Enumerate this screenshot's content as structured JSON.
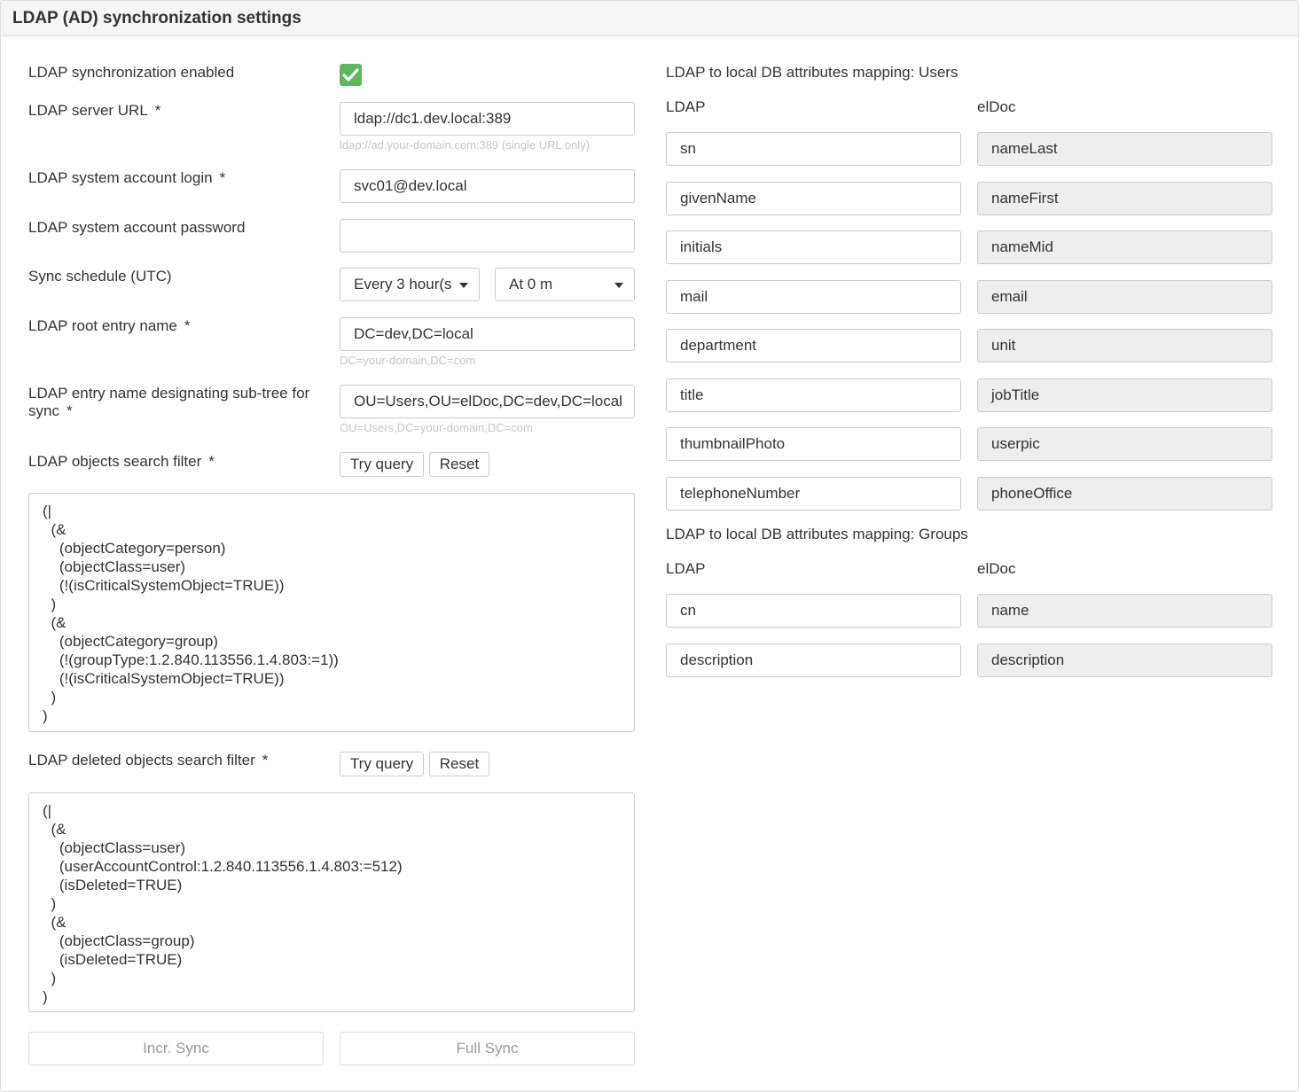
{
  "header": {
    "title": "LDAP (AD) synchronization settings"
  },
  "form": {
    "sync_enabled": {
      "label": "LDAP synchronization enabled",
      "checked": true
    },
    "server_url": {
      "label": "LDAP server URL",
      "required": "*",
      "value": "ldap://dc1.dev.local:389",
      "help": "ldap://ad.your-domain.com:389 (single URL only)"
    },
    "account_login": {
      "label": "LDAP system account login",
      "required": "*",
      "value": "svc01@dev.local"
    },
    "account_password": {
      "label": "LDAP system account password",
      "value": ""
    },
    "schedule": {
      "label": "Sync schedule (UTC)",
      "interval": "Every 3 hour(s",
      "minute": "At 0 m"
    },
    "root_entry": {
      "label": "LDAP root entry name",
      "required": "*",
      "value": "DC=dev,DC=local",
      "help": "DC=your-domain,DC=com"
    },
    "subtree": {
      "label_line1": "LDAP entry name designating sub-tree for",
      "label_line2": "sync",
      "required": "*",
      "value": "OU=Users,OU=elDoc,DC=dev,DC=local",
      "help": "OU=Users,DC=your-domain,DC=com"
    },
    "search_filter": {
      "label": "LDAP objects search filter",
      "required": "*",
      "try_label": "Try query",
      "reset_label": "Reset",
      "value": "(|\n  (&\n    (objectCategory=person)\n    (objectClass=user)\n    (!(isCriticalSystemObject=TRUE))\n  )\n  (&\n    (objectCategory=group)\n    (!(groupType:1.2.840.113556.1.4.803:=1))\n    (!(isCriticalSystemObject=TRUE))\n  )\n)"
    },
    "deleted_filter": {
      "label": "LDAP deleted objects search filter",
      "required": "*",
      "try_label": "Try query",
      "reset_label": "Reset",
      "value": "(|\n  (&\n    (objectClass=user)\n    (userAccountControl:1.2.840.113556.1.4.803:=512)\n    (isDeleted=TRUE)\n  )\n  (&\n    (objectClass=group)\n    (isDeleted=TRUE)\n  )\n)"
    },
    "incr_sync_label": "Incr. Sync",
    "full_sync_label": "Full Sync"
  },
  "users_mapping": {
    "title": "LDAP to local DB attributes mapping: Users",
    "col_ldap": "LDAP",
    "col_local": "elDoc",
    "rows": [
      {
        "ldap": "sn",
        "local": "nameLast"
      },
      {
        "ldap": "givenName",
        "local": "nameFirst"
      },
      {
        "ldap": "initials",
        "local": "nameMid"
      },
      {
        "ldap": "mail",
        "local": "email"
      },
      {
        "ldap": "department",
        "local": "unit"
      },
      {
        "ldap": "title",
        "local": "jobTitle"
      },
      {
        "ldap": "thumbnailPhoto",
        "local": "userpic"
      },
      {
        "ldap": "telephoneNumber",
        "local": "phoneOffice"
      }
    ]
  },
  "groups_mapping": {
    "title": "LDAP to local DB attributes mapping: Groups",
    "col_ldap": "LDAP",
    "col_local": "elDoc",
    "rows": [
      {
        "ldap": "cn",
        "local": "name"
      },
      {
        "ldap": "description",
        "local": "description"
      }
    ]
  },
  "colors": {
    "accent_green": "#5cb85c",
    "readonly_bg": "#eeeeee"
  },
  "icons": {
    "checkbox": "check-icon",
    "dropdown": "caret-down-icon"
  }
}
